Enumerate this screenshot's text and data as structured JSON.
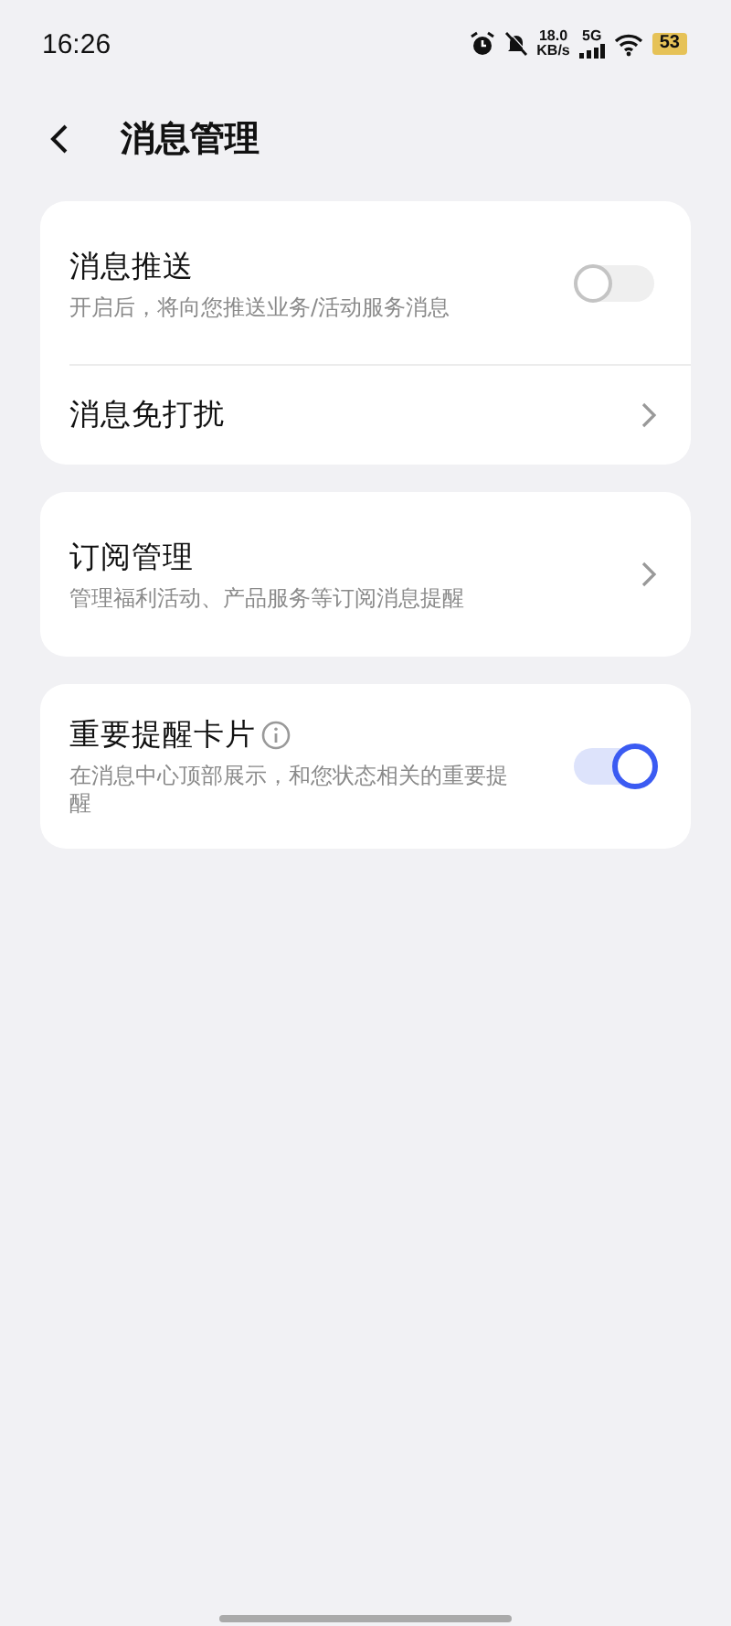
{
  "status_bar": {
    "time": "16:26",
    "speed_value": "18.0",
    "speed_unit": "KB/s",
    "network": "5G",
    "battery": "53"
  },
  "header": {
    "title": "消息管理"
  },
  "groups": [
    {
      "items": [
        {
          "kind": "toggle",
          "title": "消息推送",
          "subtitle": "开启后，将向您推送业务/活动服务消息",
          "on": false
        },
        {
          "kind": "link",
          "title": "消息免打扰"
        }
      ]
    },
    {
      "items": [
        {
          "kind": "link",
          "title": "订阅管理",
          "subtitle": "管理福利活动、产品服务等订阅消息提醒"
        }
      ]
    },
    {
      "items": [
        {
          "kind": "toggle",
          "title": "重要提醒卡片",
          "info": true,
          "subtitle": "在消息中心顶部展示，和您状态相关的重要提醒",
          "on": true
        }
      ]
    }
  ]
}
